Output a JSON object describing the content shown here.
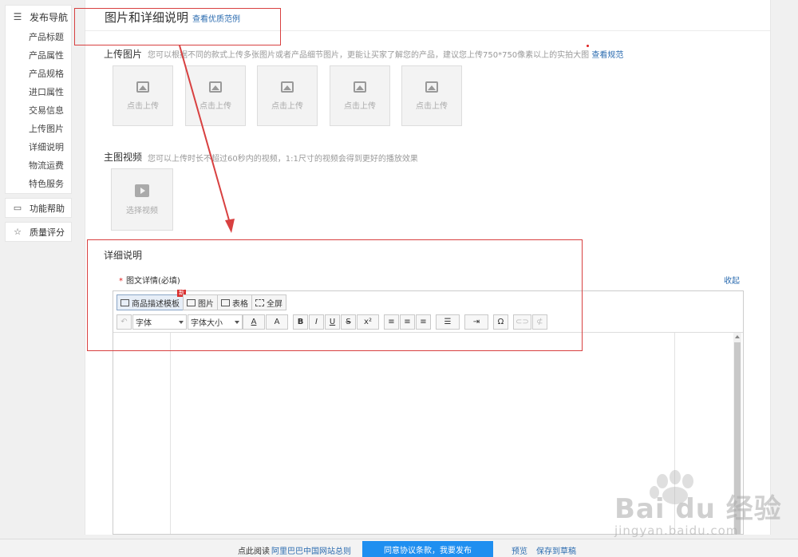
{
  "sidebar": {
    "heading": "发布导航",
    "items": [
      "产品标题",
      "产品属性",
      "产品规格",
      "进口属性",
      "交易信息",
      "上传图片",
      "详细说明",
      "物流运费",
      "特色服务"
    ],
    "help": "功能帮助",
    "quality": "质量评分"
  },
  "header": {
    "title": "图片和详细说明",
    "example_link": "查看优质范例"
  },
  "upload": {
    "label": "上传图片",
    "hint": "您可以根据不同的款式上传多张图片或者产品细节图片，更能让买家了解您的产品，建议您上传750*750像素以上的实拍大图",
    "hint_link": "查看规范",
    "boxes": [
      "点击上传",
      "点击上传",
      "点击上传",
      "点击上传",
      "点击上传"
    ]
  },
  "video": {
    "label": "主图视频",
    "hint": "您可以上传时长不超过60秒内的视频，1:1尺寸的视频会得到更好的播放效果",
    "box_label": "选择视频"
  },
  "details": {
    "label": "详细说明",
    "field_label": "图文详情(必填)",
    "required_mark": "*",
    "collapse": "收起"
  },
  "editor": {
    "tabs": [
      {
        "label": "商品描述模板",
        "badge": "新"
      },
      {
        "label": "图片"
      },
      {
        "label": "表格"
      },
      {
        "label": "全屏"
      }
    ],
    "font_select": "字体",
    "size_select": "字体大小",
    "buttons": {
      "undo": "↶",
      "text_color": "A",
      "bg_color": "A",
      "bold": "B",
      "italic": "I",
      "underline": "U",
      "strike": "S",
      "superscript": "x²",
      "align_left": "≡",
      "align_center": "≡",
      "align_right": "≡",
      "list": "☰",
      "indent": "⇥",
      "special_char": "Ω",
      "link": "⊂⊃",
      "unlink": "⊄"
    }
  },
  "bottom": {
    "read_text": "点此阅读",
    "rule_link": "阿里巴巴中国网站总则",
    "agree_button": "同意协议条款，我要发布",
    "preview": "预览",
    "save_draft": "保存到草稿"
  },
  "watermark": {
    "text": "Bai du 经验",
    "sub": "jingyan.baidu.com"
  },
  "colors": {
    "link": "#2c6cb0",
    "primary_button": "#1f8ff0",
    "annotation": "#d84040",
    "required": "#e02020"
  }
}
